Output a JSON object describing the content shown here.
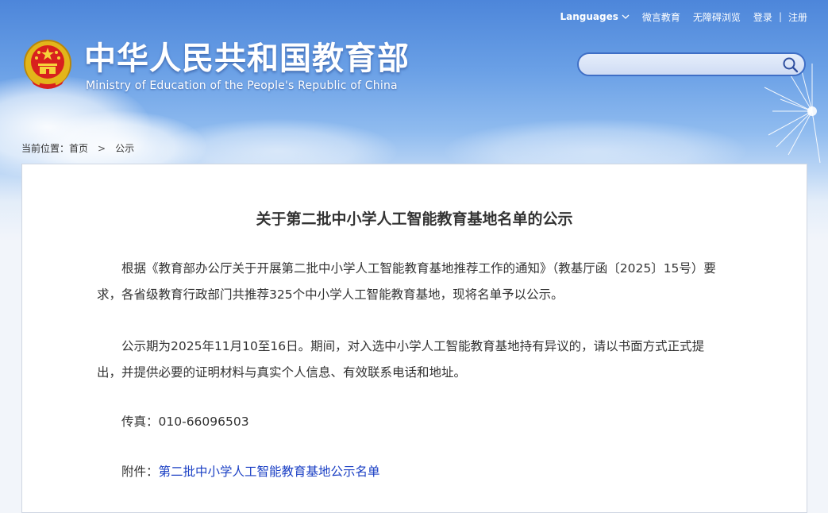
{
  "header": {
    "languages": "Languages",
    "links": [
      "微言教育",
      "无障碍浏览",
      "登录",
      "注册"
    ],
    "link_separator": "|",
    "title_cn": "中华人民共和国教育部",
    "title_en": "Ministry of Education of the People's Republic of China",
    "search_placeholder": "",
    "icons": [
      "national-emblem-icon",
      "chevron-down-icon",
      "search-icon"
    ]
  },
  "breadcrumb": {
    "prefix": "当前位置：",
    "home": "首页",
    "separator": ">",
    "current": "公示"
  },
  "article": {
    "title": "关于第二批中小学人工智能教育基地名单的公示",
    "paragraph1": "根据《教育部办公厅关于开展第二批中小学人工智能教育基地推荐工作的通知》（教基厅函〔2025〕15号）要求，各省级教育行政部门共推荐325个中小学人工智能教育基地，现将名单予以公示。",
    "paragraph2": "公示期为2025年11月10至16日。期间，对入选中小学人工智能教育基地持有异议的，请以书面方式正式提出，并提供必要的证明材料与真实个人信息、有效联系电话和地址。",
    "fax_label": "传真：",
    "fax_value": "010-66096503",
    "attachment_label": "附件：",
    "attachment_link": "第二批中小学人工智能教育基地公示名单"
  },
  "colors": {
    "link": "#1a3fc4",
    "header_sky": "#4d86da",
    "search_border": "#3f6fc6",
    "text": "#333333"
  }
}
